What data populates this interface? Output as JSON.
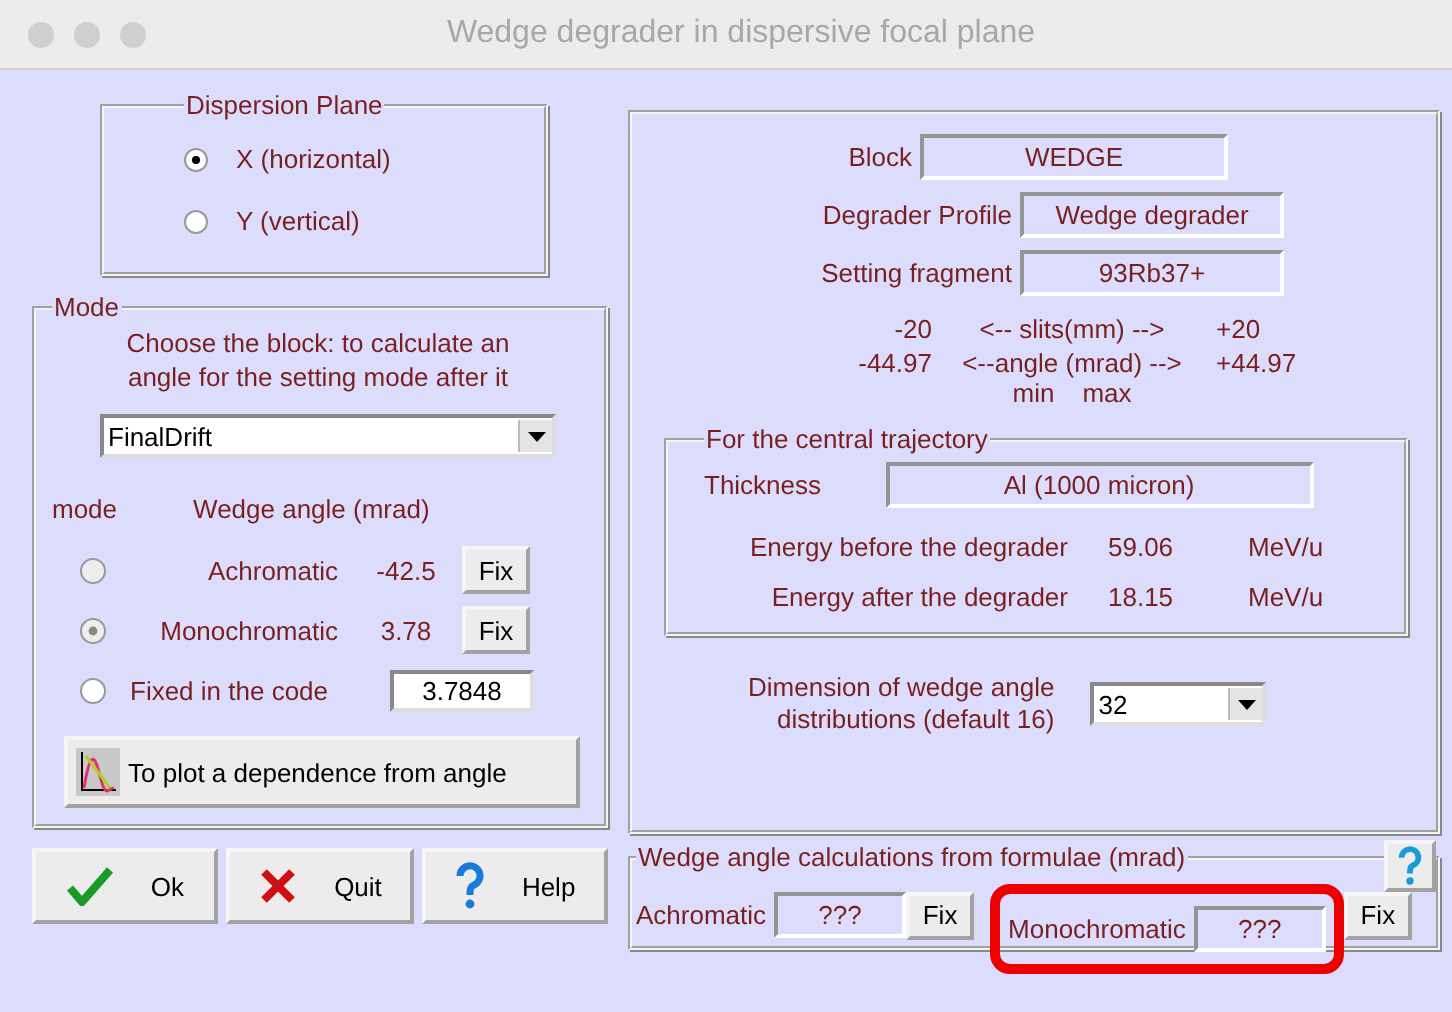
{
  "window": {
    "title": "Wedge degrader  in  dispersive focal plane"
  },
  "dispersion_plane": {
    "title": "Dispersion Plane",
    "options": [
      {
        "label": "X (horizontal)",
        "selected": true
      },
      {
        "label": "Y (vertical)",
        "selected": false
      }
    ]
  },
  "mode": {
    "title": "Mode",
    "instruction_lines": [
      "Choose the block: to calculate an",
      "angle for the setting mode after it"
    ],
    "block_select": {
      "value": "FinalDrift"
    },
    "header_mode": "mode",
    "header_angle": "Wedge angle (mrad)",
    "options": [
      {
        "kind": "fix",
        "label": "Achromatic",
        "value": "-42.5",
        "button": "Fix",
        "selected": false
      },
      {
        "kind": "fix",
        "label": "Monochromatic",
        "value": "3.78",
        "button": "Fix",
        "selected": true
      },
      {
        "kind": "input",
        "label": "Fixed in the code",
        "value": "3.7848",
        "selected": false
      }
    ],
    "plot_button": "To plot a dependence from angle"
  },
  "buttons": [
    {
      "kind": "ok",
      "label": "Ok"
    },
    {
      "kind": "quit",
      "label": "Quit"
    },
    {
      "kind": "help",
      "label": "Help"
    }
  ],
  "info": {
    "fields": [
      {
        "label": "Block",
        "value": "WEDGE"
      },
      {
        "label": "Degrader Profile",
        "value": "Wedge degrader"
      },
      {
        "label": "Setting fragment",
        "value": "93Rb37+"
      }
    ],
    "ranges": [
      {
        "min": "-20",
        "caption": "<--  slits(mm)  -->",
        "max": "+20"
      },
      {
        "min": "-44.97",
        "caption": "<--angle (mrad) -->",
        "max": "+44.97"
      }
    ],
    "min_label": "min",
    "max_label": "max"
  },
  "central": {
    "title": "For the central trajectory",
    "thickness_label": "Thickness",
    "thickness": "Al (1000 micron)",
    "energies": [
      {
        "label": "Energy before the degrader",
        "value": "59.06",
        "unit": "MeV/u"
      },
      {
        "label": "Energy after the degrader",
        "value": "18.15",
        "unit": "MeV/u"
      }
    ]
  },
  "dimension": {
    "label_lines": [
      "Dimension of wedge angle",
      "distributions  (default 16)"
    ],
    "value": "32"
  },
  "formulae": {
    "title": "Wedge angle calculations from formulae (mrad)",
    "items": [
      {
        "label": "Achromatic",
        "value": "???",
        "button": "Fix",
        "highlighted": false
      },
      {
        "label": "Monochromatic",
        "value": "???",
        "button": "Fix",
        "highlighted": true
      }
    ]
  }
}
